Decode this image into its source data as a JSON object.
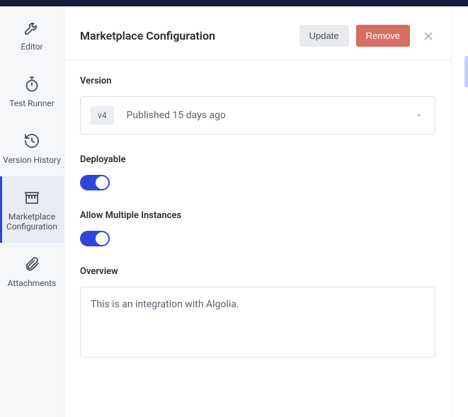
{
  "sidebar": {
    "items": [
      {
        "label": "Editor"
      },
      {
        "label": "Test Runner"
      },
      {
        "label": "Version History"
      },
      {
        "label": "Marketplace Configuration"
      },
      {
        "label": "Attachments"
      }
    ]
  },
  "header": {
    "title": "Marketplace Configuration",
    "update_label": "Update",
    "remove_label": "Remove"
  },
  "fields": {
    "version": {
      "label": "Version",
      "badge": "v4",
      "status": "Published 15 days ago"
    },
    "deployable": {
      "label": "Deployable",
      "value": true
    },
    "allow_multiple": {
      "label": "Allow Multiple Instances",
      "value": true
    },
    "overview": {
      "label": "Overview",
      "text": "This is an integration with Algolia."
    }
  },
  "colors": {
    "accent": "#2f47d8",
    "danger": "#d86d61"
  }
}
